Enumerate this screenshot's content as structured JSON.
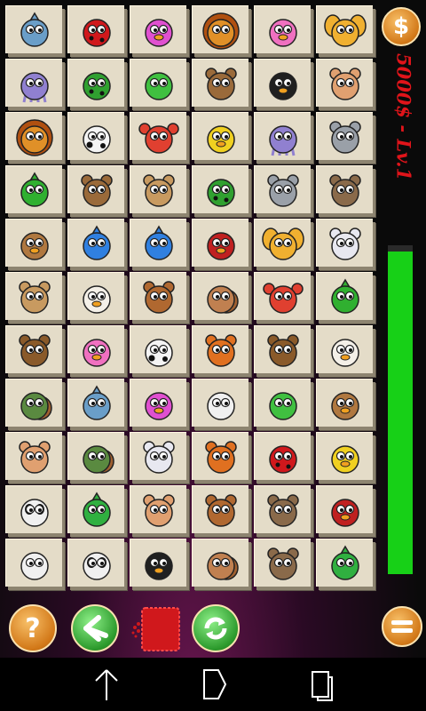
{
  "app": {
    "screen": "game-board"
  },
  "hud": {
    "coin_button_label": "$",
    "score_text": "5000$ - Lv.1",
    "timer_fraction": 0.98
  },
  "controls": {
    "hint_label": "?",
    "back": "back",
    "bomb": "bomb",
    "shuffle": "shuffle",
    "menu": "menu"
  },
  "board": {
    "rows": 11,
    "cols": 6,
    "tiles": [
      [
        "dolphin",
        "ladybug",
        "pink-pig",
        "lion",
        "flamingo",
        "butterfly"
      ],
      [
        "jellyfish",
        "frog-spotted",
        "frog",
        "bear",
        "penguin",
        "cat"
      ],
      [
        "lion",
        "cow",
        "crab",
        "duck",
        "jellyfish",
        "elephant"
      ],
      [
        "dragon",
        "bear",
        "camel",
        "frog-spotted",
        "elephant",
        "dog"
      ],
      [
        "chicken",
        "fish",
        "fish",
        "parrot",
        "butterfly",
        "rabbit"
      ],
      [
        "camel",
        "rooster",
        "owl",
        "snail",
        "crab",
        "dragon"
      ],
      [
        "buffalo",
        "flamingo",
        "cow",
        "fox",
        "buffalo",
        "rooster"
      ],
      [
        "turtle",
        "dolphin",
        "pink-pig",
        "sheep",
        "frog",
        "chicken"
      ],
      [
        "cat",
        "turtle",
        "rabbit",
        "fox",
        "ladybug",
        "duck"
      ],
      [
        "panda",
        "lizard",
        "cat",
        "owl",
        "dog",
        "parrot"
      ],
      [
        "sheep",
        "panda",
        "penguin",
        "snail",
        "dog",
        "lizard"
      ]
    ]
  },
  "palette": {
    "tile": "#e4dcc8",
    "score": "#e0141a",
    "timer": "#17d017",
    "orange_button": "#d27818",
    "green_button": "#2c9a2c"
  },
  "navbar": {
    "back": "back",
    "home": "home",
    "recent": "recent-apps"
  }
}
